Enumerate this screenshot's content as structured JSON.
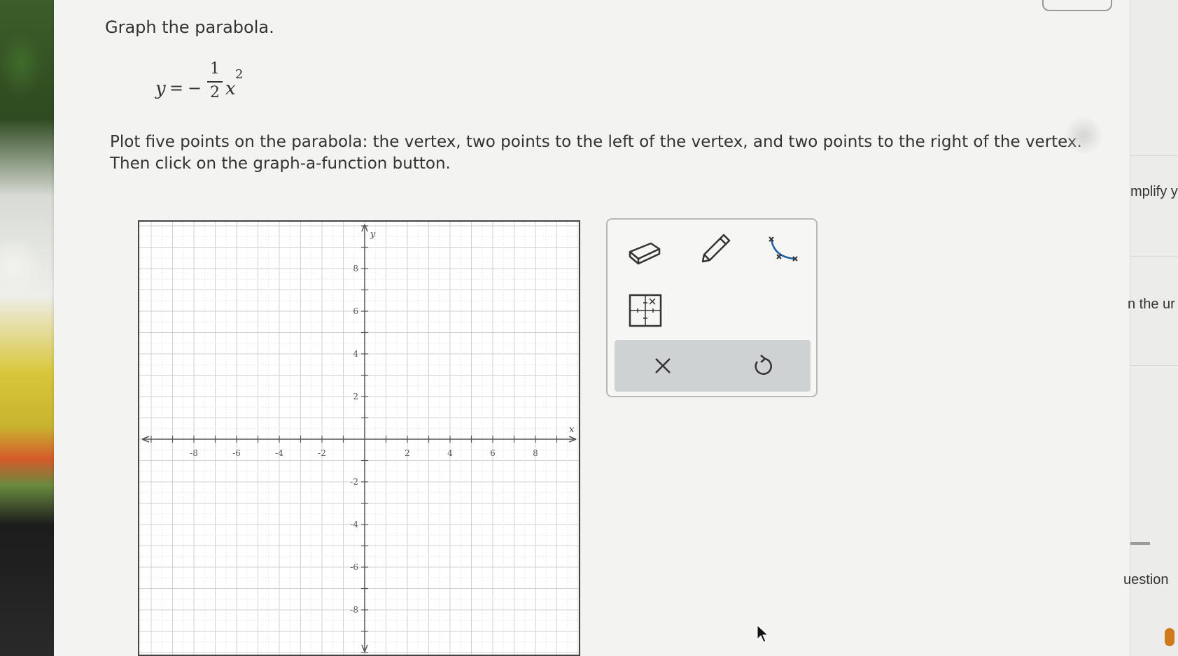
{
  "question": {
    "title": "Graph the parabola.",
    "equation": {
      "lhs": "y",
      "equals": "=",
      "sign": "−",
      "numerator": "1",
      "denominator": "2",
      "variable": "x",
      "exponent": "2"
    },
    "instructions_line1": "Plot five points on the parabola: the vertex, two points to the left of the vertex, and two points to the right of the vertex.",
    "instructions_line2": "Then click on the graph-a-function button."
  },
  "graph": {
    "x_axis_label": "x",
    "y_axis_label": "y",
    "x_ticks": [
      "-8",
      "-6",
      "-4",
      "-2",
      "2",
      "4",
      "6",
      "8"
    ],
    "y_ticks": [
      "8",
      "6",
      "4",
      "2",
      "-2",
      "-4",
      "-6",
      "-8"
    ]
  },
  "toolbox": {
    "tools": [
      {
        "name": "eraser-tool",
        "icon": "eraser-icon"
      },
      {
        "name": "pencil-tool",
        "icon": "pencil-icon"
      },
      {
        "name": "graph-function-tool",
        "icon": "parabola-points-icon"
      },
      {
        "name": "point-grid-tool",
        "icon": "grid-point-icon"
      }
    ],
    "clear_symbol": "✕",
    "undo_symbol": "↺"
  },
  "side_panel": {
    "text1": "mplify y",
    "text2": "n the ur",
    "text3": "uestion"
  },
  "colors": {
    "accent_blue": "#1f5fa8",
    "page_bg": "#f3f3f1",
    "action_bar": "#cfd2d3"
  }
}
